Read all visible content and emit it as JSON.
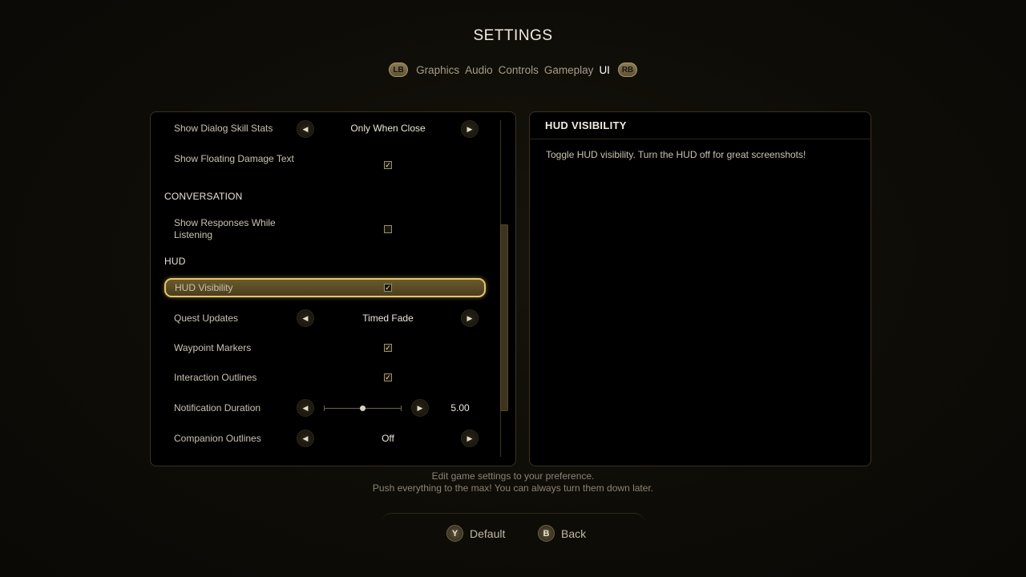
{
  "header": {
    "title": "SETTINGS"
  },
  "tabs": {
    "lb": "LB",
    "rb": "RB",
    "items": [
      {
        "label": "Graphics",
        "active": false
      },
      {
        "label": "Audio",
        "active": false
      },
      {
        "label": "Controls",
        "active": false
      },
      {
        "label": "Gameplay",
        "active": false
      },
      {
        "label": "UI",
        "active": true
      }
    ]
  },
  "settings": {
    "show_dialog_skill_stats": {
      "label": "Show Dialog Skill Stats",
      "value": "Only When Close"
    },
    "show_floating_damage_text": {
      "label": "Show Floating Damage Text",
      "checked": true
    },
    "section_conversation": "CONVERSATION",
    "show_responses_while_listening": {
      "label": "Show Responses While Listening",
      "checked": false
    },
    "section_hud": "HUD",
    "hud_visibility": {
      "label": "HUD Visibility",
      "checked": true
    },
    "quest_updates": {
      "label": "Quest Updates",
      "value": "Timed Fade"
    },
    "waypoint_markers": {
      "label": "Waypoint Markers",
      "checked": true
    },
    "interaction_outlines": {
      "label": "Interaction Outlines",
      "checked": true
    },
    "notification_duration": {
      "label": "Notification Duration",
      "value": "5.00",
      "slider_fraction": 0.5
    },
    "companion_outlines": {
      "label": "Companion Outlines",
      "value": "Off"
    }
  },
  "description": {
    "title": "HUD VISIBILITY",
    "text": "Toggle HUD visibility. Turn the HUD off for great screenshots!"
  },
  "footer": {
    "line1": "Edit game settings to your preference.",
    "line2": "Push everything to the max! You can always turn them down later.",
    "default_key": "Y",
    "default_label": "Default",
    "back_key": "B",
    "back_label": "Back"
  },
  "icons": {
    "check": "✓",
    "left_arrow": "◀",
    "right_arrow": "▶"
  },
  "colors": {
    "accent": "#e6c56b",
    "panel_bg": "#000000"
  }
}
